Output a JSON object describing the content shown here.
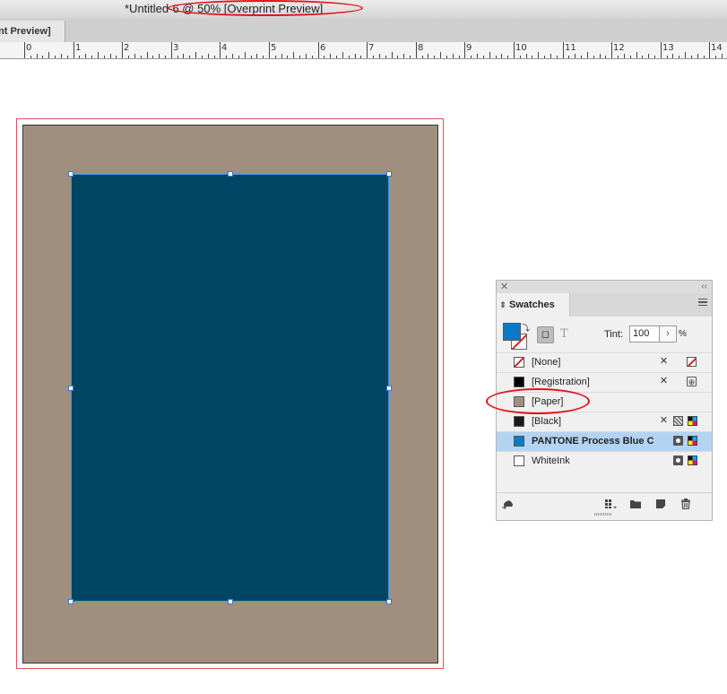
{
  "window": {
    "title": "*Untitled-6 @ 50% [Overprint Preview]"
  },
  "tab": {
    "label": "nt Preview]"
  },
  "ruler": {
    "labels": [
      "0",
      "1",
      "2",
      "3",
      "4",
      "5",
      "6",
      "7",
      "8",
      "9",
      "10",
      "11",
      "12",
      "13",
      "14"
    ]
  },
  "colors": {
    "paper": "#a08f7e",
    "rectangle_fill": "#004564",
    "selection": "#3a78c8",
    "bleed_guide": "#e0505a",
    "annotation": "#e3121a"
  },
  "swatches_panel": {
    "title": "Swatches",
    "tint_label": "Tint:",
    "tint_value": "100",
    "tint_unit": "%",
    "text_toggle": "T",
    "items": [
      {
        "name": "[None]",
        "color": "none",
        "icons": [
          "edit-disabled-icon",
          "none-icon"
        ]
      },
      {
        "name": "[Registration]",
        "color": "#000000",
        "icons": [
          "edit-disabled-icon",
          "registration-icon"
        ]
      },
      {
        "name": "[Paper]",
        "color": "#a08f7e",
        "icons": []
      },
      {
        "name": "[Black]",
        "color": "#1a1a1a",
        "icons": [
          "edit-disabled-icon",
          "grid-icon",
          "cmyk-icon"
        ]
      },
      {
        "name": "PANTONE Process Blue C",
        "color": "#0a7ac8",
        "icons": [
          "spot-icon",
          "cmyk-icon"
        ],
        "selected": true
      },
      {
        "name": "WhiteInk",
        "color": "#ffffff",
        "icons": [
          "spot-icon",
          "cmyk-icon"
        ]
      }
    ]
  }
}
